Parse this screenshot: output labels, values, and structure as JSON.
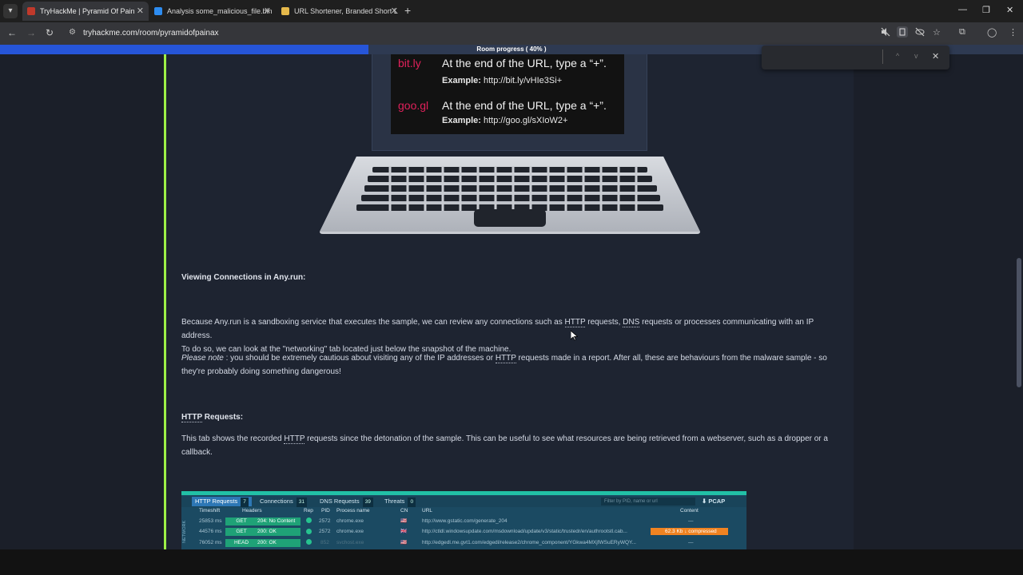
{
  "browser": {
    "tabs": [
      {
        "title": "TryHackMe | Pyramid Of Pain",
        "active": true,
        "favicon_color": "#c0392b"
      },
      {
        "title": "Analysis some_malicious_file.bin",
        "active": false,
        "favicon_color": "#2d8cf0"
      },
      {
        "title": "URL Shortener, Branded Short L",
        "active": false,
        "favicon_color": "#e5b84b"
      }
    ],
    "url": "tryhackme.com/room/pyramidofpainax",
    "icons": {
      "tab_close": "✕",
      "new_tab": "+",
      "minimize": "—",
      "restore": "❐",
      "window_close": "✕",
      "back": "←",
      "forward": "→",
      "reload": "↻",
      "site_info": "⚙",
      "star": "☆",
      "extensions": "⧉",
      "profile": "◯",
      "menu": "⋮",
      "find_up": "^",
      "find_down": "v",
      "find_close": "✕"
    }
  },
  "room_progress": {
    "label": "Room progress ( 40% )",
    "percent": 40
  },
  "illustration": {
    "row1": {
      "brand": "bit.ly",
      "text": "At the end of the URL, type a “+”.",
      "example_label": "Example:",
      "example": "http://bit.ly/vHIe3Si+"
    },
    "row2": {
      "brand": "goo.gl",
      "text": "At the end of the URL, type a “+”.",
      "example_label": "Example:",
      "example": "http://goo.gl/sXIoW2+"
    }
  },
  "article": {
    "heading_connections": "Viewing Connections in Any.run:",
    "para1_a": "Because Any.run is a sandboxing service that executes the sample, we can review any connections such as ",
    "para1_http": "HTTP",
    "para1_b": " requests, ",
    "para1_dns": "DNS",
    "para1_c": " requests or processes communicating with an IP address.",
    "para1_line2": "To do so, we can look at the \"networking\" tab located just below the snapshot of the machine.",
    "note_label": "Please note",
    "note_a": " : you should be extremely cautious about visiting any of the IP addresses or ",
    "note_http": "HTTP",
    "note_b": " requests made in a report. After all, these are behaviours from the malware sample - so",
    "note_line2": "they're probably doing something dangerous!",
    "heading_http_abbr": "HTTP",
    "heading_http_rest": " Requests:",
    "para2_a": "This tab shows the recorded ",
    "para2_http": "HTTP",
    "para2_b": " requests since the detonation of the sample. This can be useful to see what resources are being retrieved from a webserver, such as a dropper or a",
    "para2_line2": "callback."
  },
  "anyrun": {
    "tabs": [
      {
        "label": "HTTP Requests",
        "count": "7"
      },
      {
        "label": "Connections",
        "count": "31"
      },
      {
        "label": "DNS Requests",
        "count": "39"
      },
      {
        "label": "Threats",
        "count": "0"
      }
    ],
    "filter_placeholder": "Filter by PID, name or url",
    "pcap": "⬇ PCAP",
    "side_label": "NETWORK",
    "headers": [
      "Timeshift",
      "Headers",
      "Rep",
      "PID",
      "Process name",
      "CN",
      "URL",
      "Content"
    ],
    "rows": [
      {
        "time": "25853 ms",
        "method": "GET",
        "status": "204: No Content",
        "pid": "2572",
        "process": "chrome.exe",
        "cn": "🇺🇸",
        "url": "http://www.gstatic.com/generate_204",
        "content": "—"
      },
      {
        "time": "44576 ms",
        "method": "GET",
        "status": "200: OK",
        "pid": "2572",
        "process": "chrome.exe",
        "cn": "🇬🇧",
        "url": "http://ctldl.windowsupdate.com/msdownload/update/v3/static/trustedr/en/authrootstl.cab...",
        "content": "62.3 Kb  ↓ compressed"
      },
      {
        "time": "76052 ms",
        "method": "HEAD",
        "status": "200: OK",
        "pid": "852",
        "process": "svchost.exe",
        "cn": "🇺🇸",
        "url": "http://edgedl.me.gvt1.com/edgedl/release2/chrome_component/YGkwa4MXjfWSuERyWQY...",
        "content": "—"
      }
    ]
  }
}
